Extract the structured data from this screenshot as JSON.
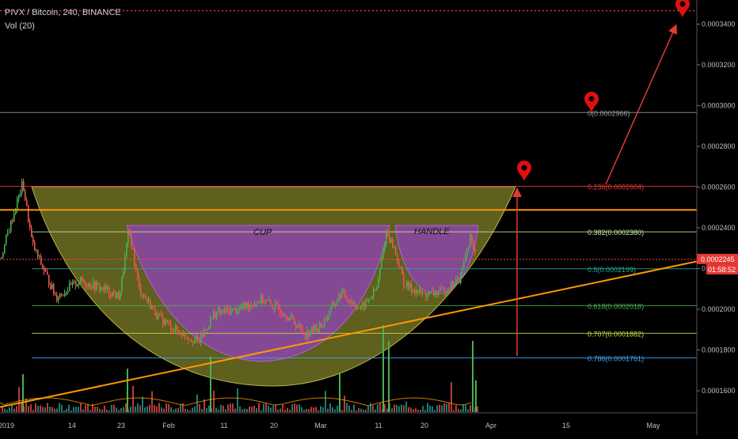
{
  "header": {
    "title": "PIVX / Bitcoin, 240, BINANCE",
    "volume": "Vol (20)"
  },
  "chart_data": {
    "type": "candlestick",
    "symbol": "PIVX / Bitcoin",
    "interval": "240",
    "exchange": "BINANCE",
    "x_ticks": [
      "2019",
      "14",
      "23",
      "Feb",
      "11",
      "20",
      "Mar",
      "11",
      "20",
      "Apr",
      "15",
      "May"
    ],
    "y_ticks": [
      "0.0001600",
      "0.0001800",
      "0.0002000",
      "0.0002200",
      "0.0002400",
      "0.0002600",
      "0.0002800",
      "0.0003000",
      "0.0003200",
      "0.0003400"
    ],
    "ylim": [
      0.000151,
      0.000357
    ],
    "current_price": "0.0002245",
    "countdown": "01:58:52",
    "fib_levels": [
      {
        "ratio": 0,
        "price": 0.0002966,
        "label": "0(0.0002966)",
        "color": "#9e9e9e"
      },
      {
        "ratio": 0.236,
        "price": 0.0002604,
        "label": "0.236(0.0002604)",
        "color": "#e53935"
      },
      {
        "ratio": 0.382,
        "price": 0.000238,
        "label": "0.382(0.0002380)",
        "color": "#c8e6a0"
      },
      {
        "ratio": 0.5,
        "price": 0.0002199,
        "label": "0.5(0.0002199)",
        "color": "#26a69a"
      },
      {
        "ratio": 0.618,
        "price": 0.0002018,
        "label": "0.618(0.0002018)",
        "color": "#4caf50"
      },
      {
        "ratio": 0.707,
        "price": 0.0001882,
        "label": "0.707(0.0001882)",
        "color": "#cddc39"
      },
      {
        "ratio": 0.786,
        "price": 0.0001761,
        "label": "0.786(0.0001761)",
        "color": "#42a5f5"
      }
    ],
    "annotations": [
      "CUP",
      "HANDLE"
    ],
    "target_line_price": 0.0003466,
    "resistance_line_price": 0.0002488,
    "trendline": {
      "from_price": 0.000152,
      "to_price": 0.0002235
    },
    "colors": {
      "up": "#26a69a",
      "up_bright": "#4caf50",
      "down": "#ef5350",
      "fib_orange": "#ff9800",
      "cup": "#8e44ad",
      "bowl": "#9a9a30",
      "target": "#e53935"
    }
  }
}
